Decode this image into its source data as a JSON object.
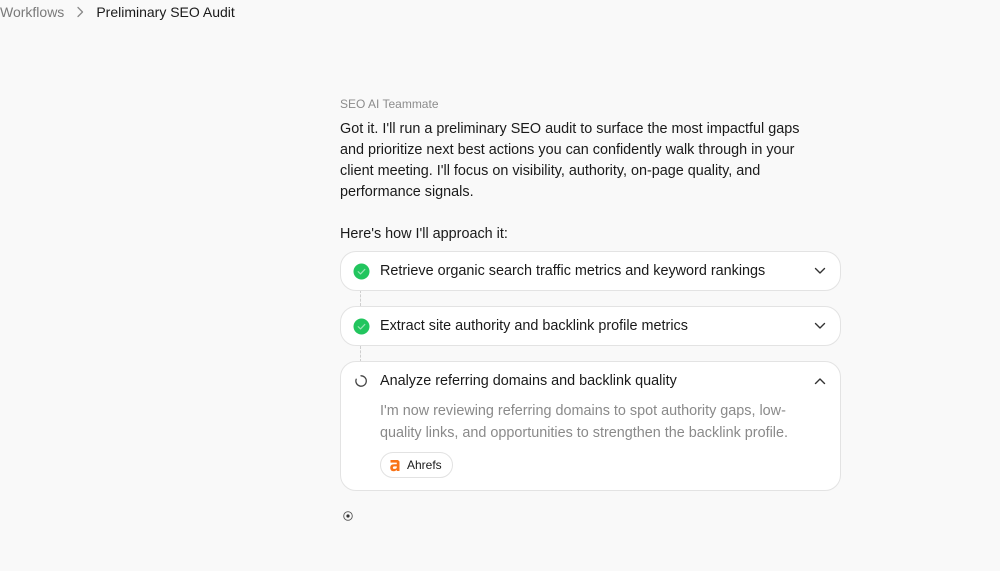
{
  "breadcrumb": {
    "parent": "Workflows",
    "current": "Preliminary SEO Audit"
  },
  "conversation": {
    "sender": "SEO AI Teammate",
    "message": "Got it. I'll run a preliminary SEO audit to surface the most impactful gaps and prioritize next best actions you can confidently walk through in your client meeting. I'll focus on visibility, authority, on-page quality, and performance signals.",
    "approach_intro": "Here's how I'll approach it:"
  },
  "steps": [
    {
      "label": "Retrieve organic search traffic metrics and keyword rankings",
      "status": "complete",
      "status_icon": "check-circle-icon",
      "expanded": false
    },
    {
      "label": "Extract site authority and backlink profile metrics",
      "status": "complete",
      "status_icon": "check-circle-icon",
      "expanded": false
    },
    {
      "label": "Analyze referring domains and backlink quality",
      "status": "in-progress",
      "status_icon": "spinner-icon",
      "expanded": true,
      "detail": "I'm now reviewing referring domains to spot authority gaps, low-quality links, and opportunities to strengthen the backlink profile.",
      "tool": "Ahrefs"
    }
  ],
  "colors": {
    "complete": "#22c55e",
    "tool_brand": "#f97316",
    "muted_text": "#8a8a8a",
    "card_border": "#e3e3e3"
  }
}
